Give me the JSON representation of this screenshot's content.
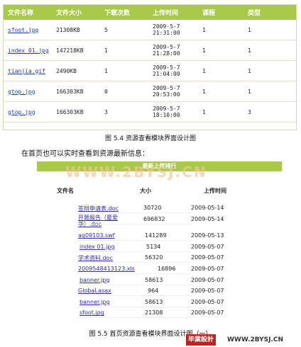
{
  "fig1": {
    "headers": [
      "文件名称",
      "文件大小",
      "下载次数",
      "上传时间",
      "课程",
      "类型"
    ],
    "rows": [
      {
        "name": "sfoot.jpg",
        "size": "21308KB",
        "downloads": "5",
        "date": "2009-5-7",
        "time": "21:31:00",
        "course": "1",
        "type": "1"
      },
      {
        "name": "index 01.jpg",
        "size": "147218KB",
        "downloads": "1",
        "date": "2009-5-7",
        "time": "21:28:00",
        "course": "1",
        "type": "1"
      },
      {
        "name": "tianjia.gif",
        "size": "2490KB",
        "downloads": "1",
        "date": "2009-5-7",
        "time": "21:04:00",
        "course": "1",
        "type": "1"
      },
      {
        "name": "gtop.jpg",
        "size": "166303KB",
        "downloads": "0",
        "date": "2009-5-7",
        "time": "20:53:00",
        "course": "1",
        "type": "1"
      },
      {
        "name": "gtop.jpg",
        "size": "166303KB",
        "downloads": "3",
        "date": "2009-5-7",
        "time": "18:10:00",
        "course": "1",
        "type": "3"
      }
    ],
    "caption": "图 5.4   资源查看模块界面设计图"
  },
  "intro": "在首页也可以实时查看到资源最新信息：",
  "fig2": {
    "title": "最新上传排行",
    "watermark": "WWW.2BYSJ.CN",
    "headers": {
      "name": "文件名",
      "size": "大小",
      "time": "上传时间"
    },
    "rows": [
      {
        "name": "答辩申请表.doc",
        "size": "30720",
        "date": "2009-05-14"
      },
      {
        "name": "开题报告（夏爱华）.doc",
        "size": "696832",
        "date": "2009-05-14"
      },
      {
        "name": "aq09103.swf",
        "size": "141289",
        "date": "2009-05-13"
      },
      {
        "name": "index 01.jpg",
        "size": "5134",
        "date": "2009-05-07"
      },
      {
        "name": "学术资料.doc",
        "size": "56320",
        "date": "2009-05-07"
      },
      {
        "name": "2009548413123.xls",
        "size": "16896",
        "date": "2009-05-07"
      },
      {
        "name": "banner.jpg",
        "size": "58613",
        "date": "2009-05-07"
      },
      {
        "name": "Global.asax",
        "size": "964",
        "date": "2009-05-07"
      },
      {
        "name": "banner.jpg",
        "size": "58613",
        "date": "2009-05-07"
      },
      {
        "name": "sfoot.jpg",
        "size": "21308",
        "date": "2009-05-07"
      }
    ],
    "caption": "图 5.5   首页资源查看模块界面设计图（一）"
  },
  "brand": {
    "left": "毕業設計",
    "right": "WWW.2BYSJ.CN",
    "color": "#c2211c"
  }
}
